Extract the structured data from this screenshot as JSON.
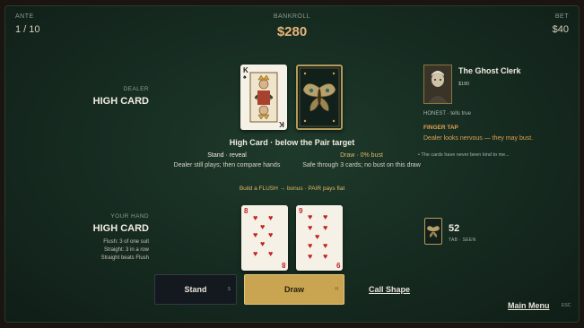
{
  "hud": {
    "ante_label": "ANTE",
    "ante_value": "1 / 10",
    "bankroll_label": "BANKROLL",
    "bankroll_value": "$280",
    "bet_label": "BET",
    "bet_value": "$40"
  },
  "dealer": {
    "label": "DEALER",
    "hand_name": "HIGH CARD",
    "cards": [
      {
        "rank": "K",
        "suit": "♠",
        "face_up": true
      },
      {
        "face_up": false
      }
    ]
  },
  "center": {
    "title": "High Card · below the Pair target",
    "stand": {
      "head": "Stand · reveal",
      "body": "Dealer still plays; then compare hands"
    },
    "draw": {
      "head": "Draw · 0% bust",
      "body": "Safe through 3 cards; no bust on this draw"
    },
    "build_line": "Build a FLUSH → bonus · PAIR pays flat"
  },
  "player": {
    "label": "YOUR HAND",
    "hand_name": "HIGH CARD",
    "hints": [
      "Flush: 3 of one suit",
      "Straight: 3 in a row",
      "Straight beats Flush"
    ],
    "cards": [
      {
        "rank": "8",
        "suit": "♥"
      },
      {
        "rank": "9",
        "suit": "♥"
      }
    ]
  },
  "actions": {
    "stand_label": "Stand",
    "stand_key": "S",
    "draw_label": "Draw",
    "draw_key": "H",
    "call_shape_label": "Call Shape"
  },
  "npc": {
    "name": "The Ghost Clerk",
    "money": "$180",
    "trait": "HONEST · tells true",
    "tell_name": "FINGER TAP",
    "tell_desc": "Dealer looks nervous — they may bust.",
    "rumor": "• The cards have never been kind to me..."
  },
  "deck": {
    "count": "52",
    "sub": "TAB · SEEN"
  },
  "menu": {
    "label": "Main Menu",
    "key": "ESC"
  },
  "colors": {
    "felt": "#1e3a2b",
    "gold_accent": "#c9a551",
    "hearts_red": "#c0231f",
    "warning_orange": "#e0a050"
  }
}
